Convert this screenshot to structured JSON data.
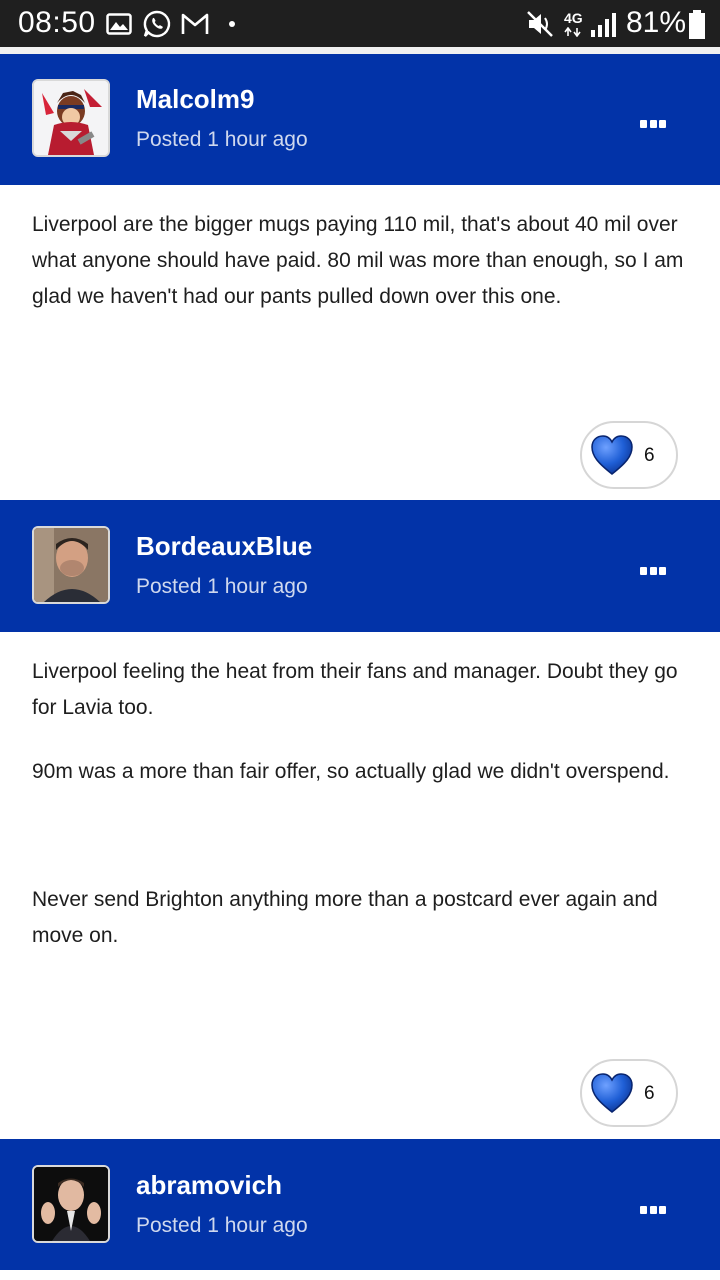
{
  "status_bar": {
    "time": "08:50",
    "network": "4G",
    "battery": "81%",
    "icons": [
      "gallery-icon",
      "whatsapp-icon",
      "gmail-icon",
      "dot-icon",
      "mute-icon",
      "signal-icon",
      "battery-icon"
    ]
  },
  "posts": [
    {
      "author": "Malcolm9",
      "posted": "Posted 1 hour ago",
      "paragraphs": [
        "Liverpool are the bigger mugs paying 110 mil, that's about 40 mil over what anyone should have paid. 80 mil was more than enough, so I am glad we haven't had our pants pulled down over this one."
      ],
      "likes": "6"
    },
    {
      "author": "BordeauxBlue",
      "posted": "Posted 1 hour ago",
      "paragraphs": [
        "Liverpool feeling the heat from their fans and manager. Doubt they go for Lavia too.",
        "90m was a more than fair offer, so actually glad we didn't overspend.",
        "Never send Brighton anything more than a postcard ever again and move on."
      ],
      "likes": "6"
    },
    {
      "author": "abramovich",
      "posted": "Posted 1 hour ago"
    }
  ],
  "colors": {
    "header_blue": "#0233a8",
    "heart_blue": "#1f5fd6",
    "status_bar": "#1f1f1f"
  }
}
